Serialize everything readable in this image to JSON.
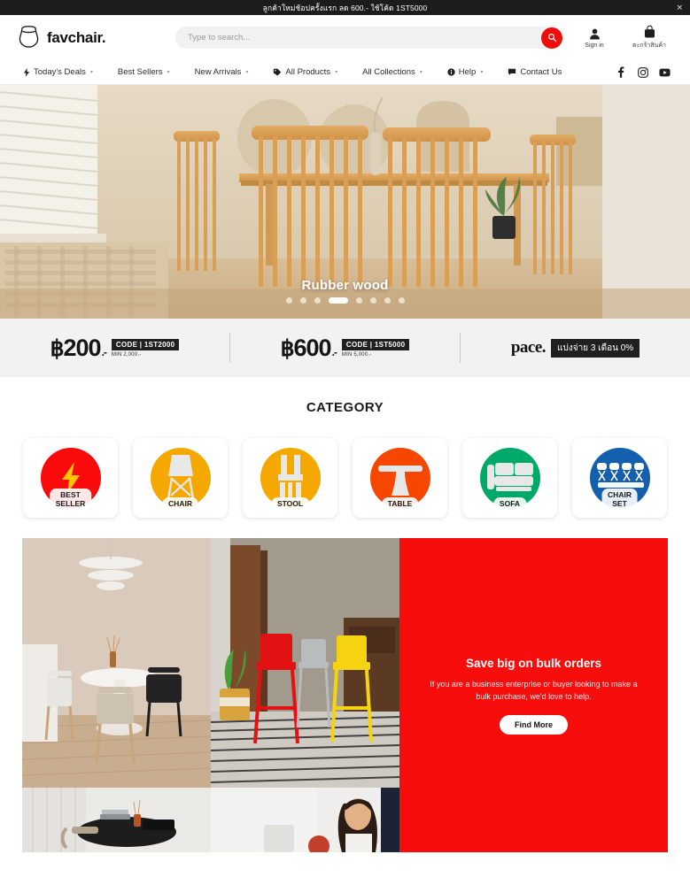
{
  "announcement": {
    "text": "ลูกค้าใหม่ช้อปครั้งแรก ลด 600.- ใช้โค้ด 1ST5000",
    "close_label": "✕"
  },
  "header": {
    "brand_name": "favchair.",
    "logo_icon": "chair-outline-icon",
    "search": {
      "placeholder": "Type to search...",
      "value": "",
      "button_icon": "search-icon",
      "button_color": "#f20d0d"
    },
    "actions": [
      {
        "label": "Sign in",
        "icon": "user-icon"
      },
      {
        "label": "ตะกร้าสินค้า",
        "icon": "shopping-bag-icon"
      }
    ]
  },
  "nav": {
    "items": [
      {
        "label": "Today's Deals",
        "icon": "bolt-icon",
        "caret": true
      },
      {
        "label": "Best Sellers",
        "icon": "",
        "caret": true
      },
      {
        "label": "New Arrivals",
        "icon": "",
        "caret": true
      },
      {
        "label": "All Products",
        "icon": "tag-icon",
        "caret": true
      },
      {
        "label": "All Collections",
        "icon": "",
        "caret": true
      },
      {
        "label": "Help",
        "icon": "info-icon",
        "caret": true
      },
      {
        "label": "Contact Us",
        "icon": "chat-icon",
        "caret": false
      }
    ],
    "socials": [
      {
        "name": "facebook-icon"
      },
      {
        "name": "instagram-icon"
      },
      {
        "name": "youtube-icon"
      }
    ]
  },
  "hero": {
    "caption": "Rubber wood",
    "dots_total": 8,
    "active_dot": 4
  },
  "promo": [
    {
      "type": "coupon",
      "currency": "฿",
      "amount": "200",
      "suffix": ".-",
      "code_label": "CODE",
      "code_value": "1ST2000",
      "min_text": "MIN 2,000.-"
    },
    {
      "type": "coupon",
      "currency": "฿",
      "amount": "600",
      "suffix": ".-",
      "code_label": "CODE",
      "code_value": "1ST5000",
      "min_text": "MIN 5,000.-"
    },
    {
      "type": "installment",
      "brand": "pace.",
      "tag": "แบ่งจ่าย 3 เดือน 0%"
    }
  ],
  "category": {
    "title": "CATEGORY",
    "items": [
      {
        "label": "BEST\nSELLER",
        "label_line1": "BEST",
        "label_line2": "SELLER",
        "icon": "bolt-icon",
        "color": "#fa0a0a"
      },
      {
        "label": "CHAIR",
        "label_line1": "CHAIR",
        "label_line2": "",
        "icon": "chair-icon",
        "color": "#f5a800"
      },
      {
        "label": "STOOL",
        "label_line1": "STOOL",
        "label_line2": "",
        "icon": "stool-icon",
        "color": "#f5a800"
      },
      {
        "label": "TABLE",
        "label_line1": "TABLE",
        "label_line2": "",
        "icon": "table-icon",
        "color": "#f64600"
      },
      {
        "label": "SOFA",
        "label_line1": "SOFA",
        "label_line2": "",
        "icon": "sofa-icon",
        "color": "#00a96a"
      },
      {
        "label": "CHAIR\nSET",
        "label_line1": "CHAIR",
        "label_line2": "SET",
        "icon": "chair-set-icon",
        "color": "#145fae"
      }
    ]
  },
  "bulk": {
    "title": "Save big on bulk orders",
    "body": "If you are a business enterprise or buyer looking to make a bulk purchase, we'd love to help.",
    "button_label": "Find More",
    "background_color": "#f80d0d"
  }
}
